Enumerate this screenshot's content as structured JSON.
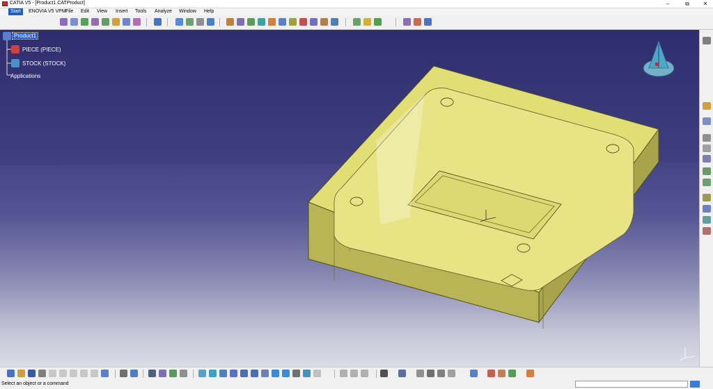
{
  "window": {
    "title": "CATIA V5 - [Product1.CATProduct]",
    "minimize": "–",
    "maximize": "⧉",
    "close": "✕"
  },
  "menu": {
    "items": [
      "Start",
      "ENOVIA V5 VPM",
      "File",
      "Edit",
      "View",
      "Insert",
      "Tools",
      "Analyze",
      "Window",
      "Help"
    ]
  },
  "tree": {
    "root": "Product1",
    "children": [
      "PIECE (PIECE)",
      "STOCK (STOCK)"
    ],
    "applications": "Applications"
  },
  "model": {
    "body_color": "#e4e07a",
    "edge_color": "#5a5a1e",
    "description_icons": [
      "product-icon",
      "part-icon",
      "compass-icon",
      "axis-icon"
    ]
  },
  "status": {
    "message": "Select an object or a command",
    "command_value": ""
  },
  "colors": {
    "background_top": "#2e2e6e",
    "background_bottom": "#dcdce6",
    "selection": "#2a5fd0",
    "part_fill": "#e4e07a"
  }
}
